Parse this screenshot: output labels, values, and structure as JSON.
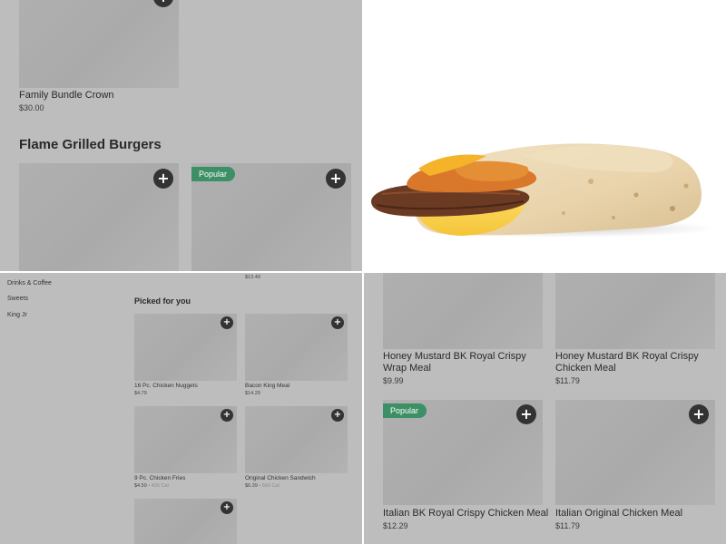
{
  "top_left": {
    "family_bundle": {
      "name": "Family Bundle Crown",
      "price": "$30.00"
    },
    "section_title": "Flame Grilled Burgers",
    "popular_badge": "Popular",
    "add_icon": "+"
  },
  "top_right": {
    "image": "breakfast-burrito-photo"
  },
  "bottom_left": {
    "top_price": "$13.49",
    "nav": [
      "Drinks & Coffee",
      "Sweets",
      "King Jr"
    ],
    "section_title": "Picked for you",
    "items": [
      {
        "name": "16 Pc. Chicken Nuggets",
        "price": "$4.79",
        "cal": ""
      },
      {
        "name": "Bacon King Meal",
        "price": "$14.29",
        "cal": ""
      },
      {
        "name": "9 Pc. Chicken Fries",
        "price": "$4.59",
        "cal": " • 430 Cal."
      },
      {
        "name": "Original Chicken Sandwich",
        "price": "$6.39",
        "cal": " • 660 Cal."
      }
    ]
  },
  "bottom_right": {
    "popular_badge": "Popular",
    "items": [
      {
        "name": "Honey Mustard BK Royal Crispy Wrap Meal",
        "price": "$9.99"
      },
      {
        "name": "Honey Mustard BK Royal Crispy Chicken Meal",
        "price": "$11.79"
      },
      {
        "name": "Italian BK Royal Crispy Chicken Meal",
        "price": "$12.29"
      },
      {
        "name": "Italian Original Chicken Meal",
        "price": "$11.79"
      }
    ]
  }
}
